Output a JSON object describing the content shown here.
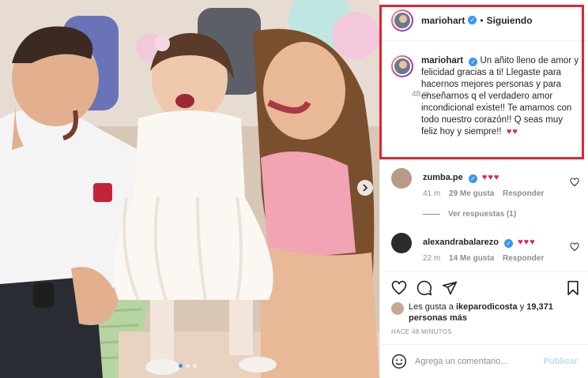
{
  "post": {
    "username": "mariohart",
    "follow_status": "Siguiendo",
    "bullet": "•",
    "verified_mark": "✓",
    "caption": "Un añito lleno de amor y felicidad gracias a ti! Llegaste para hacernos mejores personas y para enseñarnos q el verdadero amor incondicional existe!! Te amamos con todo nuestro corazón!! Q seas muy feliz hoy y siempre!!",
    "caption_hearts": "♥♥",
    "caption_time": "48 m"
  },
  "comments": [
    {
      "username": "zumba.pe",
      "hearts": "♥♥♥",
      "time": "41 m",
      "likes": "29 Me gusta",
      "reply_label": "Responder",
      "avatar_color": "#b89a86"
    },
    {
      "username": "alexandrabalarezo",
      "hearts": "♥♥♥",
      "time": "22 m",
      "likes": "14 Me gusta",
      "reply_label": "Responder",
      "avatar_color": "#2b2b2b"
    }
  ],
  "view_replies": "Ver respuestas (1)",
  "likes": {
    "prefix": "Les gusta a ",
    "user": "ikeparodicosta",
    "connector": " y ",
    "count": "19,371 personas más"
  },
  "post_age": "HACE 48 MINUTOS",
  "add_comment": {
    "placeholder": "Agrega un comentario...",
    "publish_label": "Publicar"
  },
  "icons": {
    "like": "heart-outline-icon",
    "comment": "comment-bubble-icon",
    "share": "paper-plane-icon",
    "save": "bookmark-icon",
    "emoji": "smiley-icon",
    "next": "chevron-right-icon"
  },
  "colors": {
    "verified": "#3897f0",
    "highlight": "#e02432",
    "heart": "#e0245e",
    "publish_disabled": "#b2dffc"
  },
  "carousel": {
    "slides": 3,
    "active_index": 0
  }
}
